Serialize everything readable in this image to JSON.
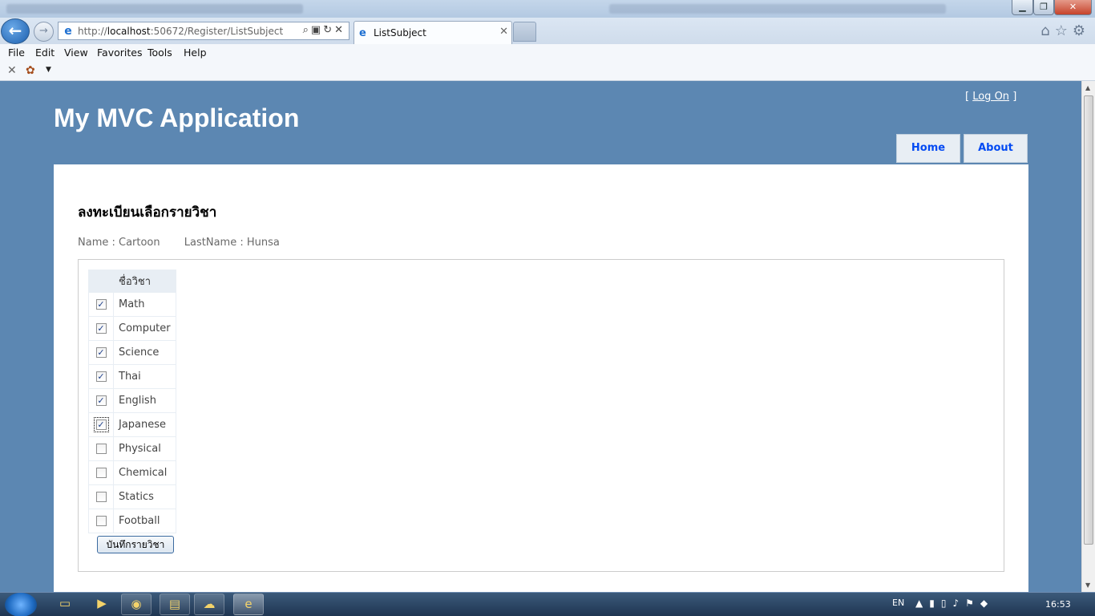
{
  "browser": {
    "address_scheme": "http://",
    "address_host": "localhost",
    "address_path": ":50672/Register/ListSubject",
    "tab_title": "ListSubject",
    "menu": [
      "File",
      "Edit",
      "View",
      "Favorites",
      "Tools",
      "Help"
    ]
  },
  "header": {
    "logon_open": "[",
    "logon_label": "Log On",
    "logon_close": "]",
    "site_title": "My MVC Application",
    "nav": [
      "Home",
      "About"
    ]
  },
  "page": {
    "heading": "ลงทะเบียนเลือกรายวิชา",
    "name_label": "Name : Cartoon",
    "lastname_label": "LastName : Hunsa",
    "table_header": "ชื่อวิชา",
    "subjects": [
      {
        "name": "Math",
        "checked": true
      },
      {
        "name": "Computer",
        "checked": true
      },
      {
        "name": "Science",
        "checked": true
      },
      {
        "name": "Thai",
        "checked": true
      },
      {
        "name": "English",
        "checked": true
      },
      {
        "name": "Japanese",
        "checked": true
      },
      {
        "name": "Physical",
        "checked": false
      },
      {
        "name": "Chemical",
        "checked": false
      },
      {
        "name": "Statics",
        "checked": false
      },
      {
        "name": "Football",
        "checked": false
      }
    ],
    "save_button": "บันทึกรายวิชา"
  },
  "taskbar": {
    "language": "EN",
    "clock": "16:53"
  },
  "colors": {
    "page_background": "#5c87b2",
    "nav_link": "#034af3",
    "table_border": "#e8eef4"
  }
}
